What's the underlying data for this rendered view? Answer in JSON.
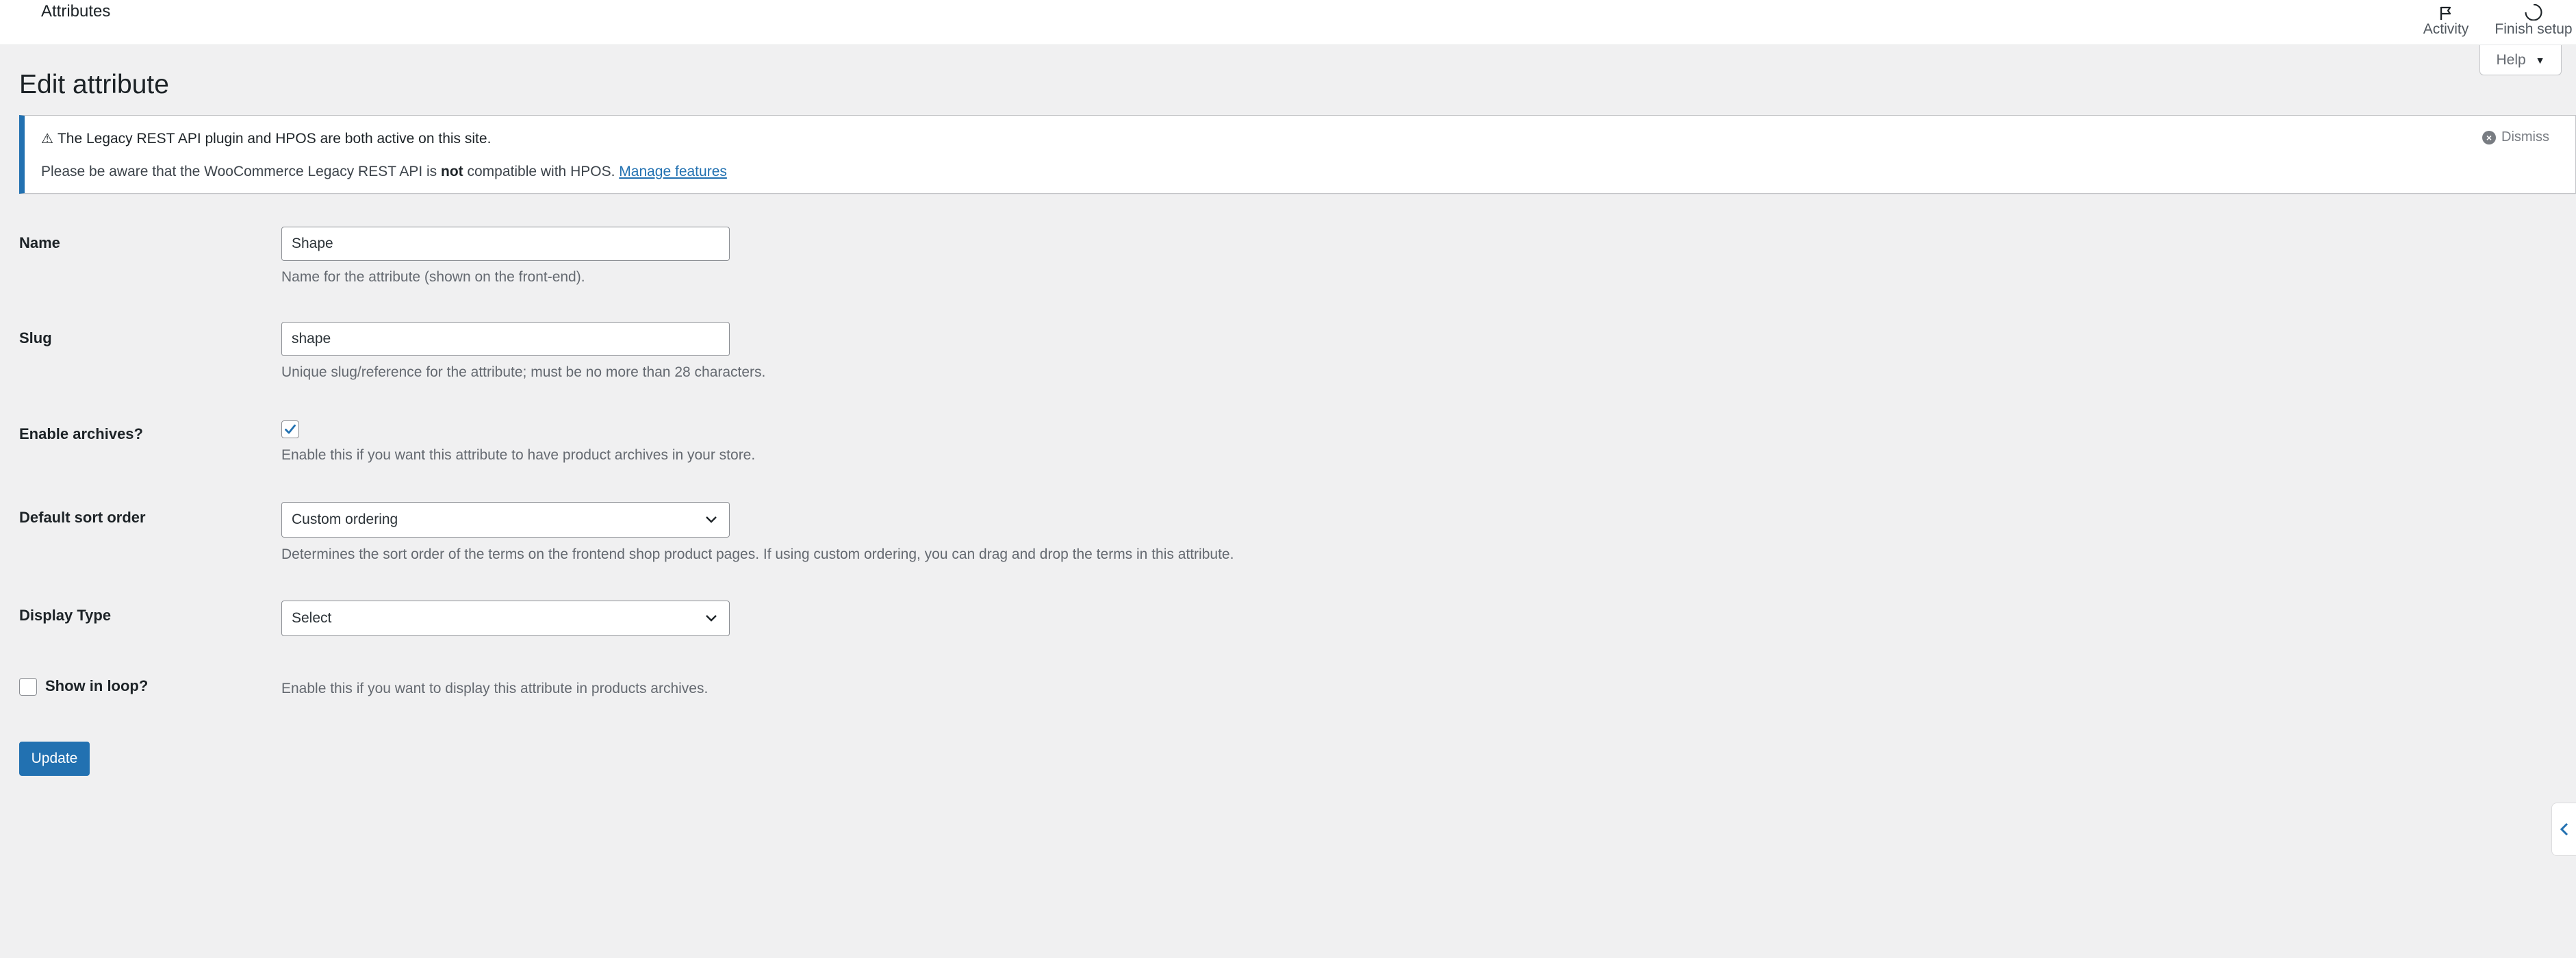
{
  "header": {
    "title": "Attributes",
    "actions": {
      "activity": {
        "label": "Activity",
        "icon": "flag-icon"
      },
      "finish_setup": {
        "label": "Finish setup",
        "icon": "progress-circle-icon"
      }
    }
  },
  "help_tab": {
    "label": "Help",
    "icon": "caret-down-icon"
  },
  "page_title": "Edit attribute",
  "notice": {
    "title": "The Legacy REST API plugin and HPOS are both active on this site.",
    "icon": "warning-icon",
    "text_before": "Please be aware that the WooCommerce Legacy REST API is ",
    "text_bold": "not",
    "text_after": " compatible with HPOS. ",
    "link": "Manage features",
    "dismiss": "Dismiss"
  },
  "form": {
    "name": {
      "label": "Name",
      "value": "Shape",
      "description": "Name for the attribute (shown on the front-end)."
    },
    "slug": {
      "label": "Slug",
      "value": "shape",
      "description": "Unique slug/reference for the attribute; must be no more than 28 characters."
    },
    "enable_archives": {
      "label": "Enable archives?",
      "checked": true,
      "description": "Enable this if you want this attribute to have product archives in your store."
    },
    "default_sort_order": {
      "label": "Default sort order",
      "selected": "Custom ordering",
      "description": "Determines the sort order of the terms on the frontend shop product pages. If using custom ordering, you can drag and drop the terms in this attribute."
    },
    "display_type": {
      "label": "Display Type",
      "selected": "Select"
    },
    "show_in_loop": {
      "label": "Show in loop?",
      "checked": false,
      "description": "Enable this if you want to display this attribute in products archives."
    },
    "submit_label": "Update"
  },
  "colors": {
    "accent": "#2271b1",
    "background": "#f0f0f1",
    "text": "#1d2327",
    "muted": "#646970"
  }
}
